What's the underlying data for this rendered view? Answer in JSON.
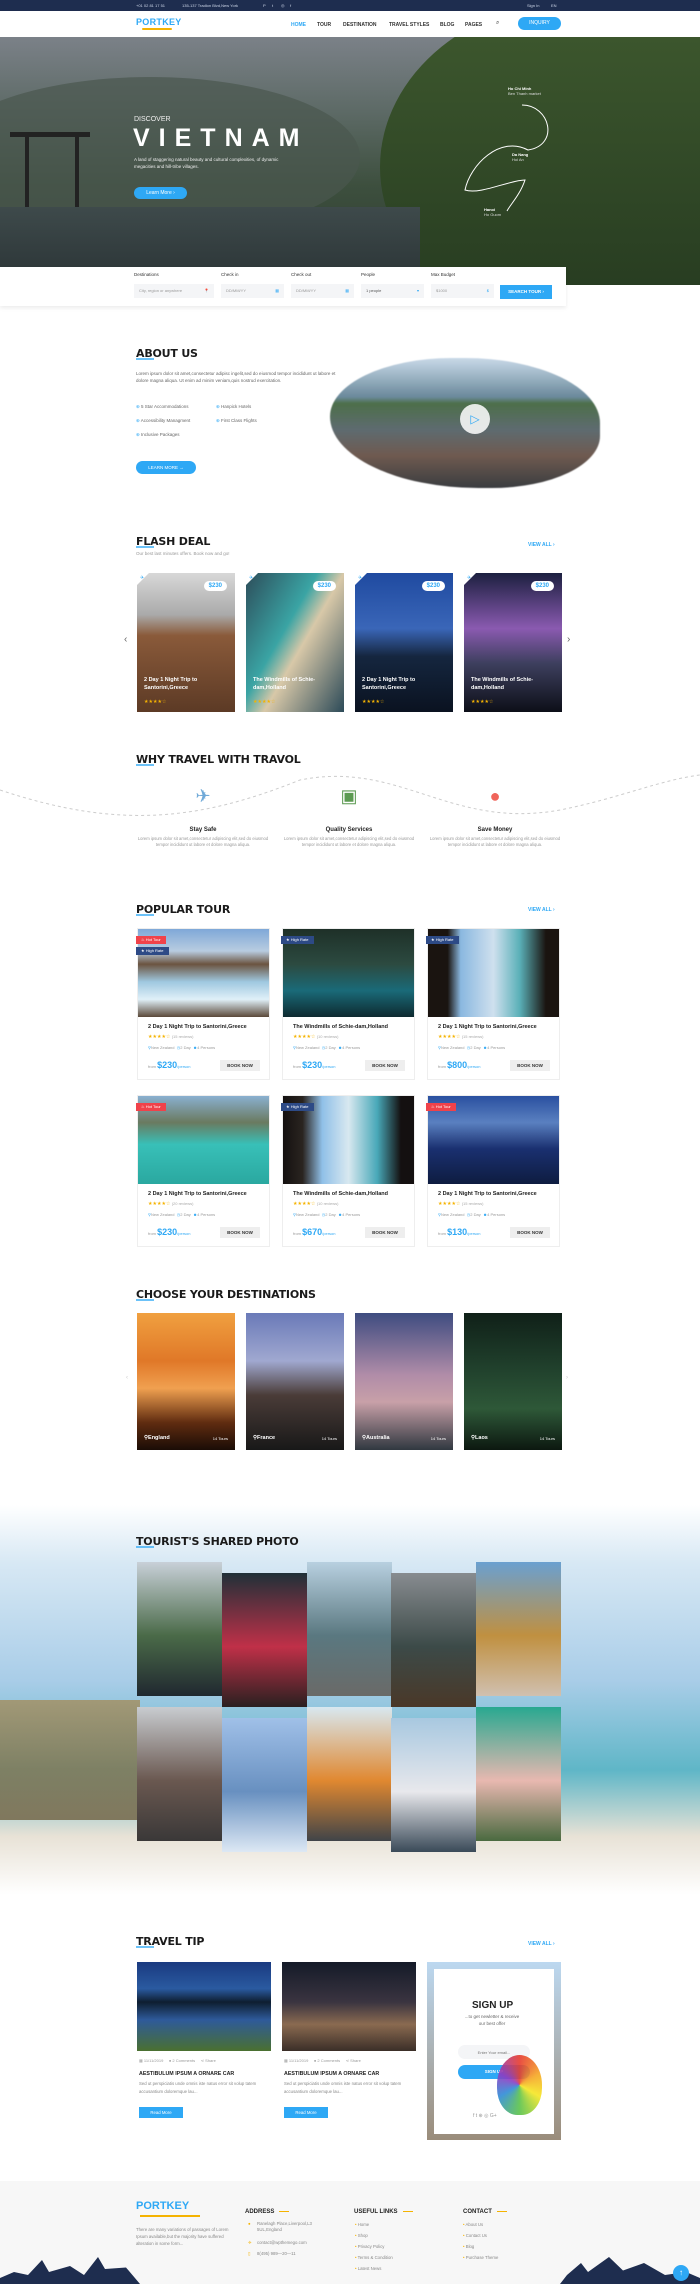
{
  "topbar": {
    "phone": "+01 02 81 17 51",
    "address": "135-137 Tradlon Blvd,New York",
    "signin": "Sign In",
    "lang": "EN"
  },
  "nav": {
    "logo": "PORTKEY",
    "items": [
      "HOME",
      "TOUR",
      "DESTINATION",
      "TRAVEL STYLES",
      "BLOG",
      "PAGES"
    ],
    "inquiry": "INQUIRY",
    "accent": "#2ea8f5",
    "dark": "#1e2d4f"
  },
  "hero": {
    "discover": "DISCOVER",
    "title": "VIETNAM",
    "text": "A land of staggering natural beauty and cultural complexities, of dynamic megacities and hill-tribe villages.",
    "button": "Learn More ›",
    "cities": [
      {
        "name": "Ho Chi Minh",
        "sub": "Ben Thanh market"
      },
      {
        "name": "Da Nang",
        "sub": "Hoi An"
      },
      {
        "name": "Hanoi",
        "sub": "Ho Guom"
      }
    ]
  },
  "search": {
    "fields": [
      {
        "label": "Destinations",
        "placeholder": "City, region or anywhere"
      },
      {
        "label": "Check in",
        "placeholder": "DD/MM/YY"
      },
      {
        "label": "Check out",
        "placeholder": "DD/MM/YY"
      },
      {
        "label": "People",
        "value": "1 people"
      },
      {
        "label": "Max Budget",
        "placeholder": "$1000"
      }
    ],
    "button": "SEARCH TOUR ›"
  },
  "about": {
    "title": "ABOUT US",
    "text": "Lorem ipsum dolor sit amet,consectetur adipisc ingelit,sed do eiusmod tempor incididunt ut labore et dolore magna aliqua. Ut enim ad minim veniam,quis nostrud exercitation.",
    "features": [
      "5 Star Accommodations",
      "Hanpick Hotels",
      "Accessibility Managment",
      "First Class Flights",
      "Inclusive Packages"
    ],
    "button": "LEARN MORE →"
  },
  "flash": {
    "title": "FLASH DEAL",
    "subtitle": "Our best last minutes offers. Book now and go!",
    "view_all": "VIEW ALL ›",
    "cards": [
      {
        "price": "$230",
        "title": "2 Day 1 Night Trip to Santorini,Greece",
        "rating": 4
      },
      {
        "price": "$230",
        "title": "The Windmills of Schie-dam,Holland",
        "rating": 4
      },
      {
        "price": "$230",
        "title": "2 Day 1 Night Trip to Santorini,Greece",
        "rating": 4
      },
      {
        "price": "$230",
        "title": "The Windmills of Schie-dam,Holland",
        "rating": 4
      }
    ]
  },
  "why": {
    "title": "WHY TRAVEL WITH TRAVOL",
    "items": [
      {
        "title": "Stay Safe",
        "icon": "airplane-icon",
        "text": "Lorem ipsum dolor sit amet,consectetur adipiscing elit,sed do eiusmod tempor incididunt ut labore et dolore magna aliqua."
      },
      {
        "title": "Quality Services",
        "icon": "passport-icon",
        "text": "Lorem ipsum dolor sit amet,consectetur adipiscing elit,sed do eiusmod tempor incididunt ut labore et dolore magna aliqua."
      },
      {
        "title": "Save Money",
        "icon": "piggy-bank-icon",
        "text": "Lorem ipsum dolor sit amet,consectetur adipiscing elit,sed do eiusmod tempor incididunt ut labore et dolore magna aliqua."
      }
    ]
  },
  "popular": {
    "title": "POPULAR TOUR",
    "view_all": "VIEW ALL ›",
    "from": "from",
    "per": "/person",
    "book": "BOOK NOW",
    "tours": [
      {
        "badges": [
          "Hot Tour",
          "High Rate"
        ],
        "title": "2 Day 1 Night Trip to Santorini,Greece",
        "rating": 4,
        "reviews": "(15 reviews)",
        "location": "New Zealand",
        "days": "2 Day",
        "persons": "4 Persons",
        "price": "$230"
      },
      {
        "badges": [
          "High Rate"
        ],
        "title": "The Windmills of Schie-dam,Holland",
        "rating": 4,
        "reviews": "(10 reviews)",
        "location": "New Zealand",
        "days": "2 Day",
        "persons": "4 Persons",
        "price": "$230"
      },
      {
        "badges": [
          "High Rate"
        ],
        "title": "2 Day 1 Night Trip to Santorini,Greece",
        "rating": 4,
        "reviews": "(15 reviews)",
        "location": "New Zealand",
        "days": "2 Day",
        "persons": "4 Persons",
        "price": "$800"
      },
      {
        "badges": [
          "Hot Tour"
        ],
        "title": "2 Day 1 Night Trip to Santorini,Greece",
        "rating": 4,
        "reviews": "(20 reviews)",
        "location": "New Zealand",
        "days": "2 Day",
        "persons": "4 Persons",
        "price": "$230"
      },
      {
        "badges": [
          "High Rate"
        ],
        "title": "The Windmills of Schie-dam,Holland",
        "rating": 4,
        "reviews": "(10 reviews)",
        "location": "New Zealand",
        "days": "2 Day",
        "persons": "4 Persons",
        "price": "$670"
      },
      {
        "badges": [
          "Hot Tour"
        ],
        "title": "2 Day 1 Night Trip to Santorini,Greece",
        "rating": 4,
        "reviews": "(15 reviews)",
        "location": "New Zealand",
        "days": "2 Day",
        "persons": "4 Persons",
        "price": "$130"
      }
    ]
  },
  "destinations": {
    "title": "CHOOSE YOUR DESTINATIONS",
    "items": [
      {
        "name": "England",
        "tours": "14 Tours"
      },
      {
        "name": "France",
        "tours": "14 Tours"
      },
      {
        "name": "Australia",
        "tours": "14 Tours"
      },
      {
        "name": "Laos",
        "tours": "14 Tours"
      }
    ]
  },
  "photos": {
    "title": "TOURIST'S SHARED PHOTO"
  },
  "tips": {
    "title": "TRAVEL TIP",
    "view_all": "VIEW ALL ›",
    "posts": [
      {
        "date": "11/11/2019",
        "comments": "2 Comments",
        "share": "Share",
        "title": "AESTIBULUM IPSUM A ORNARE CAR",
        "text": "Sed ut perspiciatis unde omnis iste natus error sit volup tatem accusantium doloremque lau...",
        "button": "Read More"
      },
      {
        "date": "11/11/2019",
        "comments": "2 Comments",
        "share": "Share",
        "title": "AESTIBULUM IPSUM A ORNARE CAR",
        "text": "Sed ut perspiciatis unde omnis iste natus error sit volup tatem accusantium doloremque lau...",
        "button": "Read More"
      }
    ],
    "signup": {
      "title": "SIGN UP",
      "text": "...to get newletter & receive our best offer",
      "placeholder": "Enter Your email...",
      "button": "SIGN UP"
    }
  },
  "footer": {
    "logo": "PORTKEY",
    "text": "There are many variations of passages of Lorem Ipsum available,but the majority have suffered alteration in some form...",
    "address_title": "ADDRESS",
    "address": "Ranelagh Place,Liverpool,L3 5UL,England",
    "email": "contact@wpthemego.com",
    "phone": "8(495) 989—20—11",
    "links_title": "USEFUL LINKS",
    "links": [
      "Home",
      "Shop",
      "Privacy Policy",
      "Terms & Condition",
      "Latest News"
    ],
    "contact_title": "CONTACT",
    "contact": [
      "About Us",
      "Contact Us",
      "Blog",
      "Purchase Theme"
    ]
  }
}
